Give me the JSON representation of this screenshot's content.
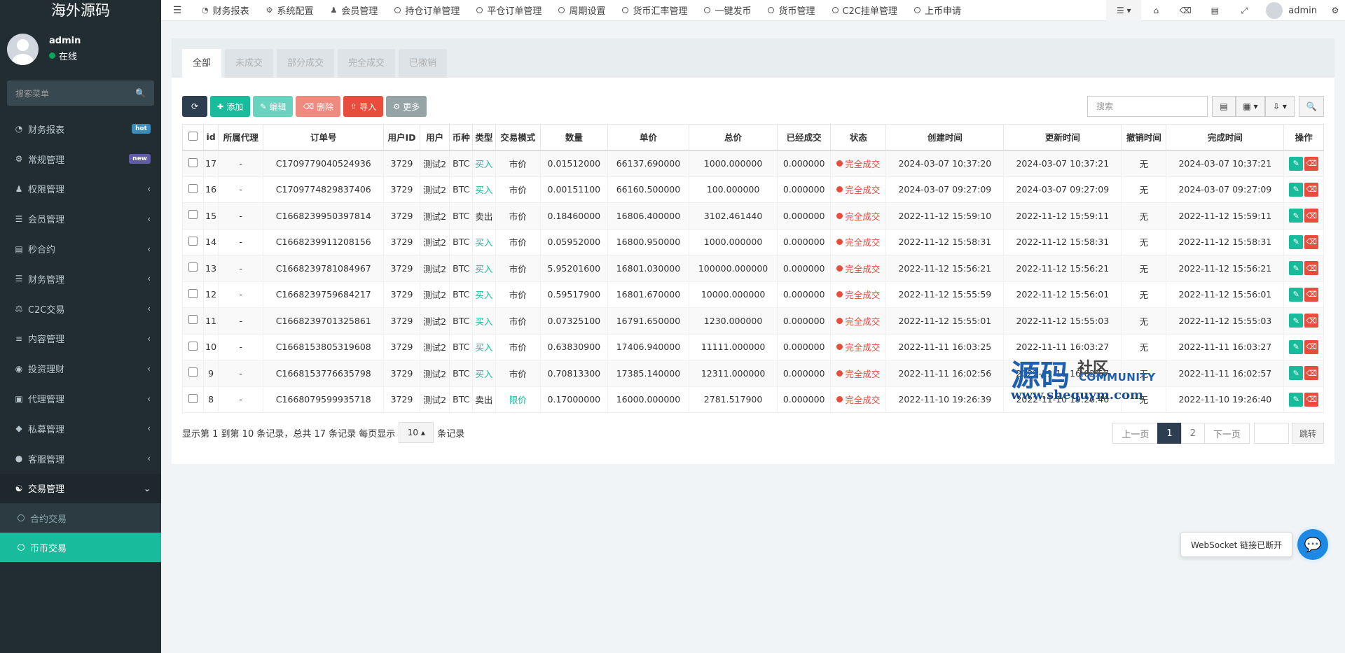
{
  "brand": "海外源码",
  "user": {
    "name": "admin",
    "status": "在线"
  },
  "sidebar": {
    "search_placeholder": "搜索菜单",
    "items": [
      {
        "label": "财务报表",
        "icon": "dashboard-icon",
        "badge": "hot"
      },
      {
        "label": "常规管理",
        "icon": "cogs-icon",
        "badge": "new"
      },
      {
        "label": "权限管理",
        "icon": "group-icon"
      },
      {
        "label": "会员管理",
        "icon": "list-icon"
      },
      {
        "label": "秒合约",
        "icon": "calendar-icon"
      },
      {
        "label": "财务管理",
        "icon": "database-icon"
      },
      {
        "label": "C2C交易",
        "icon": "balance-scale-icon"
      },
      {
        "label": "内容管理",
        "icon": "align-left-icon"
      },
      {
        "label": "投资理财",
        "icon": "compass-icon"
      },
      {
        "label": "代理管理",
        "icon": "briefcase-icon"
      },
      {
        "label": "私募管理",
        "icon": "diamond-icon"
      },
      {
        "label": "客服管理",
        "icon": "comment-icon"
      },
      {
        "label": "交易管理",
        "icon": "handshake-icon"
      }
    ],
    "sub_items": [
      {
        "label": "合约交易"
      },
      {
        "label": "币币交易"
      }
    ]
  },
  "topbar": {
    "tabs": [
      {
        "label": "财务报表",
        "icon": "dashboard-icon"
      },
      {
        "label": "系统配置",
        "icon": "gear-icon"
      },
      {
        "label": "会员管理",
        "icon": "user-icon"
      },
      {
        "label": "持仓订单管理",
        "icon": "circle-icon"
      },
      {
        "label": "平仓订单管理",
        "icon": "circle-icon"
      },
      {
        "label": "周期设置",
        "icon": "circle-icon"
      },
      {
        "label": "货币汇率管理",
        "icon": "circle-icon"
      },
      {
        "label": "一键发币",
        "icon": "circle-icon"
      },
      {
        "label": "货币管理",
        "icon": "circle-icon"
      },
      {
        "label": "C2C挂单管理",
        "icon": "circle-icon"
      },
      {
        "label": "上币申请",
        "icon": "circle-icon"
      }
    ],
    "admin_name": "admin"
  },
  "status_tabs": [
    "全部",
    "未成交",
    "部分成交",
    "完全成交",
    "已撤销"
  ],
  "toolbar": {
    "add": "添加",
    "edit": "编辑",
    "delete": "删除",
    "import": "导入",
    "more": "更多",
    "search_placeholder": "搜索"
  },
  "table": {
    "headers": [
      "id",
      "所属代理",
      "订单号",
      "用户ID",
      "用户",
      "币种",
      "类型",
      "交易模式",
      "数量",
      "单价",
      "总价",
      "已经成交",
      "状态",
      "创建时间",
      "更新时间",
      "撤销时间",
      "完成时间",
      "操作"
    ],
    "rows": [
      [
        "17",
        "-",
        "C1709779040524936",
        "3729",
        "测试2",
        "BTC",
        "买入",
        "市价",
        "0.01512000",
        "66137.690000",
        "1000.000000",
        "0.000000",
        "完全成交",
        "2024-03-07 10:37:20",
        "2024-03-07 10:37:21",
        "无",
        "2024-03-07 10:37:21"
      ],
      [
        "16",
        "-",
        "C1709774829837406",
        "3729",
        "测试2",
        "BTC",
        "买入",
        "市价",
        "0.00151100",
        "66160.500000",
        "100.000000",
        "0.000000",
        "完全成交",
        "2024-03-07 09:27:09",
        "2024-03-07 09:27:09",
        "无",
        "2024-03-07 09:27:09"
      ],
      [
        "15",
        "-",
        "C1668239950397814",
        "3729",
        "测试2",
        "BTC",
        "卖出",
        "市价",
        "0.18460000",
        "16806.400000",
        "3102.461440",
        "0.000000",
        "完全成交",
        "2022-11-12 15:59:10",
        "2022-11-12 15:59:11",
        "无",
        "2022-11-12 15:59:11"
      ],
      [
        "14",
        "-",
        "C1668239911208156",
        "3729",
        "测试2",
        "BTC",
        "买入",
        "市价",
        "0.05952000",
        "16800.950000",
        "1000.000000",
        "0.000000",
        "完全成交",
        "2022-11-12 15:58:31",
        "2022-11-12 15:58:31",
        "无",
        "2022-11-12 15:58:31"
      ],
      [
        "13",
        "-",
        "C1668239781084967",
        "3729",
        "测试2",
        "BTC",
        "买入",
        "市价",
        "5.95201600",
        "16801.030000",
        "100000.000000",
        "0.000000",
        "完全成交",
        "2022-11-12 15:56:21",
        "2022-11-12 15:56:21",
        "无",
        "2022-11-12 15:56:21"
      ],
      [
        "12",
        "-",
        "C1668239759684217",
        "3729",
        "测试2",
        "BTC",
        "买入",
        "市价",
        "0.59517900",
        "16801.670000",
        "10000.000000",
        "0.000000",
        "完全成交",
        "2022-11-12 15:55:59",
        "2022-11-12 15:56:01",
        "无",
        "2022-11-12 15:56:01"
      ],
      [
        "11",
        "-",
        "C1668239701325861",
        "3729",
        "测试2",
        "BTC",
        "买入",
        "市价",
        "0.07325100",
        "16791.650000",
        "1230.000000",
        "0.000000",
        "完全成交",
        "2022-11-12 15:55:01",
        "2022-11-12 15:55:03",
        "无",
        "2022-11-12 15:55:03"
      ],
      [
        "10",
        "-",
        "C1668153805319608",
        "3729",
        "测试2",
        "BTC",
        "买入",
        "市价",
        "0.63830900",
        "17406.940000",
        "11111.000000",
        "0.000000",
        "完全成交",
        "2022-11-11 16:03:25",
        "2022-11-11 16:03:27",
        "无",
        "2022-11-11 16:03:27"
      ],
      [
        "9",
        "-",
        "C1668153776635798",
        "3729",
        "测试2",
        "BTC",
        "买入",
        "市价",
        "0.70813300",
        "17385.140000",
        "12311.000000",
        "0.000000",
        "完全成交",
        "2022-11-11 16:02:56",
        "2022-11-11 16:02:57",
        "无",
        "2022-11-11 16:02:57"
      ],
      [
        "8",
        "-",
        "C1668079599935718",
        "3729",
        "测试2",
        "BTC",
        "卖出",
        "限价",
        "0.17000000",
        "16000.000000",
        "2781.517900",
        "0.000000",
        "完全成交",
        "2022-11-10 19:26:39",
        "2022-11-10 19:26:40",
        "无",
        "2022-11-10 19:26:40"
      ]
    ]
  },
  "pager": {
    "info_prefix": "显示第 1 到第 10 条记录，总共 17 条记录 每页显示",
    "page_size": "10",
    "info_suffix": "条记录",
    "prev": "上一页",
    "pages": [
      "1",
      "2"
    ],
    "next": "下一页",
    "go": "跳转"
  },
  "watermark": {
    "main": "源码",
    "sub": "社区",
    "community": "COMMUNITY",
    "url": "www.shequym.com"
  },
  "ws_toast": "WebSocket 链接已断开",
  "colors": {
    "sidebar_bg": "#222d32",
    "accent": "#18bc9c",
    "danger": "#e74c3c",
    "dark": "#2c3e50"
  }
}
